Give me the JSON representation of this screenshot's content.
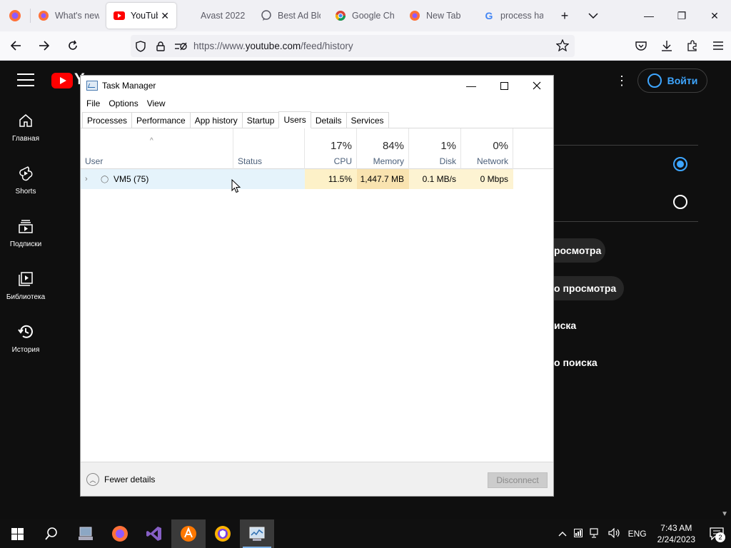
{
  "browser": {
    "tabs": [
      {
        "label": "What's new",
        "active": false
      },
      {
        "label": "YouTube",
        "active": true
      },
      {
        "label": "Avast 2022",
        "active": false
      },
      {
        "label": "Best Ad Blo",
        "active": false
      },
      {
        "label": "Google Ch",
        "active": false
      },
      {
        "label": "New Tab",
        "active": false
      },
      {
        "label": "process ha",
        "active": false
      }
    ],
    "url_prefix": "https://www.",
    "url_domain": "youtube.com",
    "url_path": "/feed/history"
  },
  "youtube": {
    "logo_text": "Y",
    "signin_label": "Войти",
    "sidebar": [
      {
        "label": "Главная",
        "icon": "home-icon"
      },
      {
        "label": "Shorts",
        "icon": "shorts-icon"
      },
      {
        "label": "Подписки",
        "icon": "subscriptions-icon"
      },
      {
        "label": "Библиотека",
        "icon": "library-icon"
      },
      {
        "label": "История",
        "icon": "history-icon"
      }
    ],
    "panel_texts": [
      "росмотра",
      "о просмотра",
      "иска",
      "о поиска"
    ]
  },
  "taskmanager": {
    "title": "Task Manager",
    "menu": [
      "File",
      "Options",
      "View"
    ],
    "tabs": [
      "Processes",
      "Performance",
      "App history",
      "Startup",
      "Users",
      "Details",
      "Services"
    ],
    "active_tab": "Users",
    "columns": {
      "user": "User",
      "status": "Status",
      "cpu": {
        "pct": "17%",
        "name": "CPU"
      },
      "memory": {
        "pct": "84%",
        "name": "Memory"
      },
      "disk": {
        "pct": "1%",
        "name": "Disk"
      },
      "network": {
        "pct": "0%",
        "name": "Network"
      }
    },
    "rows": [
      {
        "user": "VM5 (75)",
        "status": "",
        "cpu": "11.5%",
        "memory": "1,447.7 MB",
        "disk": "0.1 MB/s",
        "network": "0 Mbps"
      }
    ],
    "fewer_details": "Fewer details",
    "disconnect": "Disconnect"
  },
  "taskbar": {
    "language": "ENG",
    "time": "7:43 AM",
    "date": "2/24/2023",
    "notification_count": "2"
  }
}
